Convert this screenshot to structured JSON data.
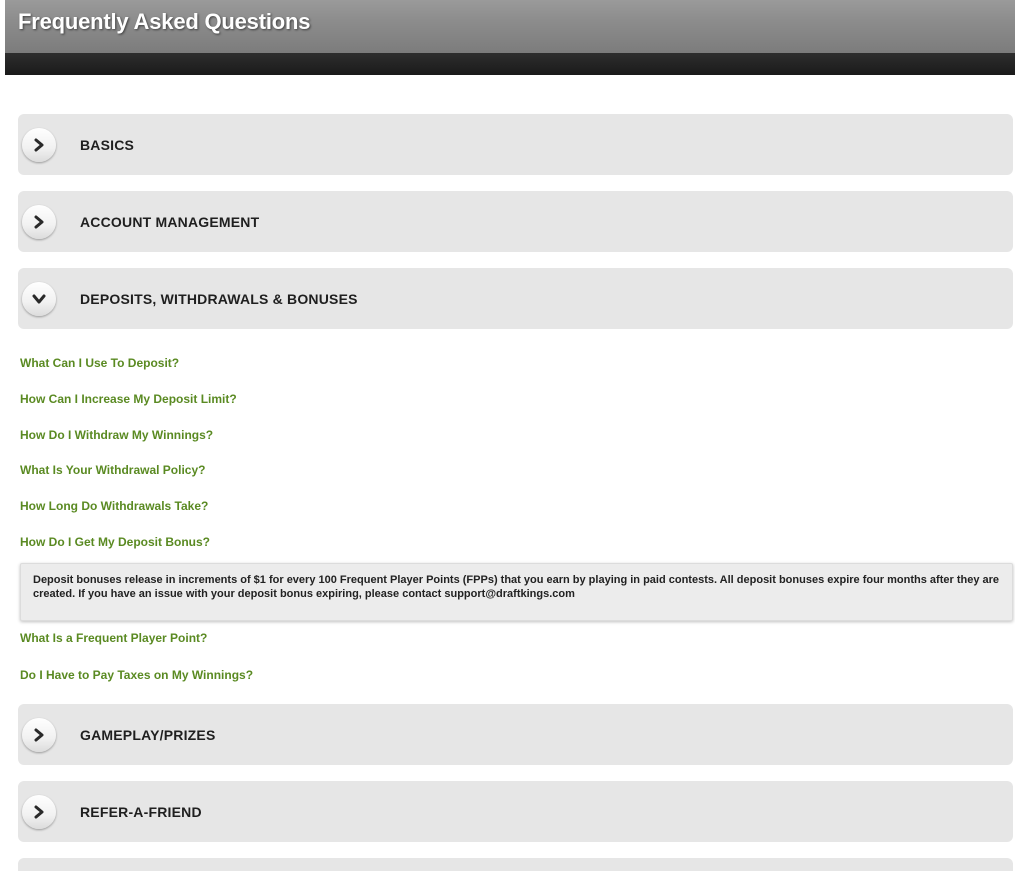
{
  "header": {
    "title": "Frequently Asked Questions"
  },
  "sections": [
    {
      "title": "BASICS",
      "expanded": false,
      "icon": "chevron-right-icon"
    },
    {
      "title": "ACCOUNT MANAGEMENT",
      "expanded": false,
      "icon": "chevron-right-icon"
    },
    {
      "title": "DEPOSITS, WITHDRAWALS & BONUSES",
      "expanded": true,
      "icon": "chevron-down-icon"
    },
    {
      "title": "GAMEPLAY/PRIZES",
      "expanded": false,
      "icon": "chevron-right-icon"
    },
    {
      "title": "REFER-A-FRIEND",
      "expanded": false,
      "icon": "chevron-right-icon"
    }
  ],
  "questions": [
    "What Can I Use To Deposit?",
    "How Can I Increase My Deposit Limit?",
    "How Do I Withdraw My Winnings?",
    "What Is Your Withdrawal Policy?",
    "How Long Do Withdrawals Take?",
    "How Do I Get My Deposit Bonus?",
    "What Is a Frequent Player Point?",
    "Do I Have to Pay Taxes on My Winnings?"
  ],
  "answer": {
    "text": "Deposit bonuses release in increments of $1 for every 100 Frequent Player Points (FPPs) that you earn by playing in paid contests. All deposit bonuses expire four months after they are created. If you have an issue with your deposit bonus expiring, please contact support@draftkings.com"
  },
  "colors": {
    "link": "#5a8a22",
    "section_bg": "#e6e6e6",
    "header_bg": "#8c8c8c"
  }
}
